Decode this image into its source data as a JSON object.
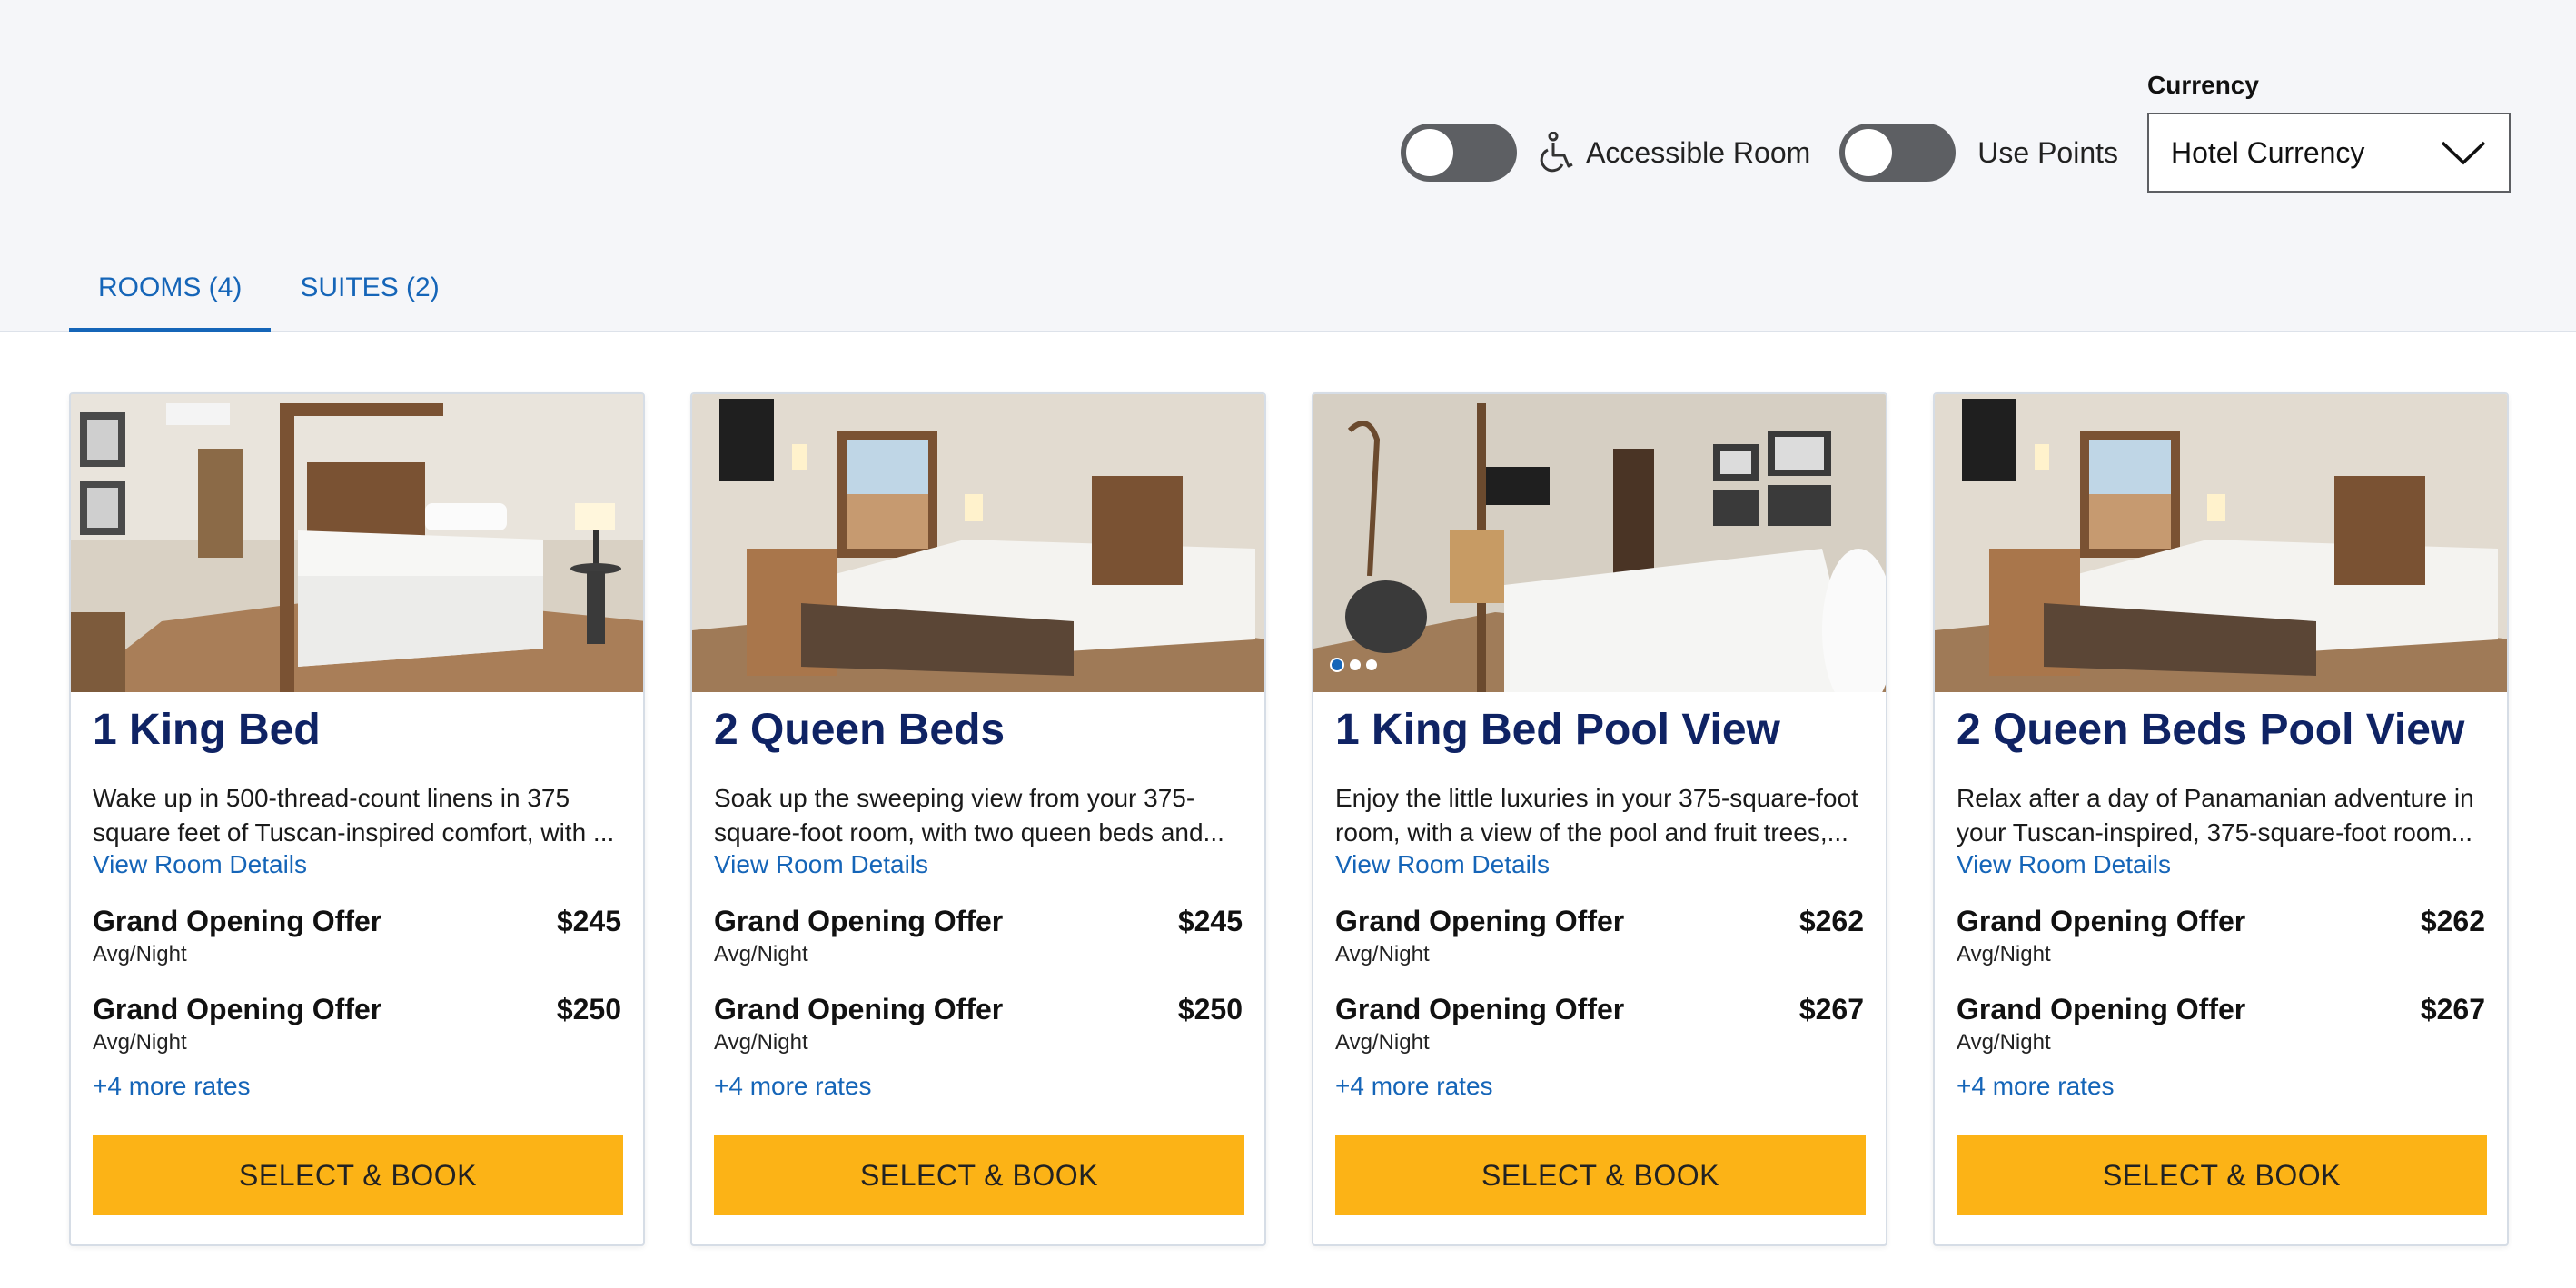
{
  "filters": {
    "accessible_label": "Accessible Room",
    "points_label": "Use Points",
    "currency_label": "Currency",
    "currency_value": "Hotel Currency"
  },
  "tabs": [
    {
      "label": "ROOMS (4)",
      "active": true
    },
    {
      "label": "SUITES (2)",
      "active": false
    }
  ],
  "cards": [
    {
      "title": "1 King Bed",
      "desc_line1": "Wake up in 500-thread-count linens in 375",
      "desc_line2": "square feet of Tuscan-inspired comfort, with ...",
      "details_link": "View Room Details",
      "rates": [
        {
          "name": "Grand Opening Offer",
          "price": "$245",
          "sub": "Avg/Night"
        },
        {
          "name": "Grand Opening Offer",
          "price": "$250",
          "sub": "Avg/Night"
        }
      ],
      "more_rates": "+4 more rates",
      "button": "SELECT & BOOK"
    },
    {
      "title": "2 Queen Beds",
      "desc_line1": "Soak up the sweeping view from your 375-",
      "desc_line2": "square-foot room, with two queen beds and...",
      "details_link": "View Room Details",
      "rates": [
        {
          "name": "Grand Opening Offer",
          "price": "$245",
          "sub": "Avg/Night"
        },
        {
          "name": "Grand Opening Offer",
          "price": "$250",
          "sub": "Avg/Night"
        }
      ],
      "more_rates": "+4 more rates",
      "button": "SELECT & BOOK"
    },
    {
      "title": "1 King Bed Pool View",
      "desc_line1": "Enjoy the little luxuries in your 375-square-foot",
      "desc_line2": "room, with a view of the pool and fruit trees,...",
      "details_link": "View Room Details",
      "rates": [
        {
          "name": "Grand Opening Offer",
          "price": "$262",
          "sub": "Avg/Night"
        },
        {
          "name": "Grand Opening Offer",
          "price": "$267",
          "sub": "Avg/Night"
        }
      ],
      "more_rates": "+4 more rates",
      "button": "SELECT & BOOK"
    },
    {
      "title": "2 Queen Beds Pool View",
      "desc_line1": "Relax after a day of Panamanian adventure in",
      "desc_line2": "your Tuscan-inspired, 375-square-foot room...",
      "details_link": "View Room Details",
      "rates": [
        {
          "name": "Grand Opening Offer",
          "price": "$262",
          "sub": "Avg/Night"
        },
        {
          "name": "Grand Opening Offer",
          "price": "$267",
          "sub": "Avg/Night"
        }
      ],
      "more_rates": "+4 more rates",
      "button": "SELECT & BOOK"
    }
  ],
  "colors": {
    "brand_navy": "#0f2364",
    "link_blue": "#1565b8",
    "cta_yellow": "#fcb316",
    "toggle_off": "#5d5f63"
  }
}
